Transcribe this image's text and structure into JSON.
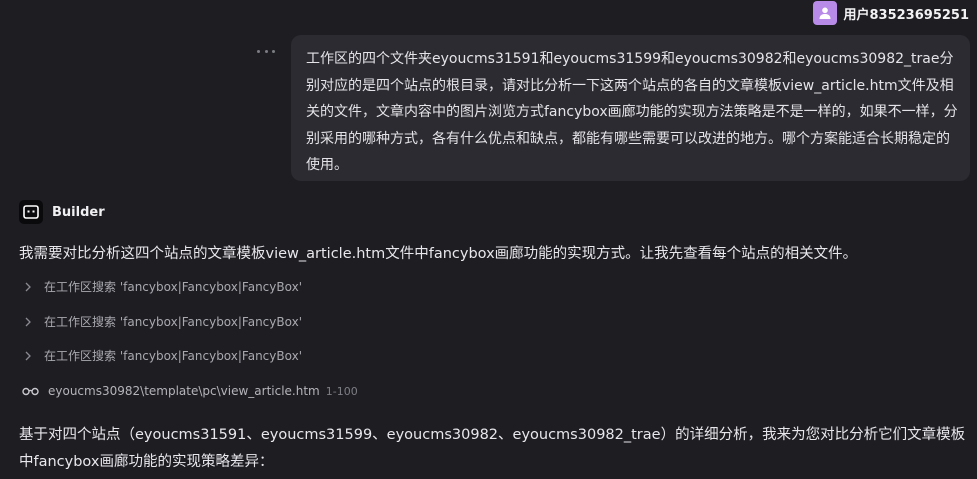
{
  "user": {
    "name": "用户83523695251",
    "avatar_icon": "person-icon",
    "avatar_color": "#b98be8"
  },
  "user_message": {
    "text": "工作区的四个文件夹eyoucms31591和eyoucms31599和eyoucms30982和eyoucms30982_trae分别对应的是四个站点的根目录，请对比分析一下这两个站点的各自的文章模板view_article.htm文件及相关的文件，文章内容中的图片浏览方式fancybox画廊功能的实现方法策略是不是一样的，如果不一样，分别采用的哪种方式，各有什么优点和缺点，都能有哪些需要可以改进的地方。哪个方案能适合长期稳定的使用。",
    "more_icon": "more-dots-icon"
  },
  "assistant": {
    "name": "Builder",
    "logo_icon": "builder-logo-icon",
    "intro": "我需要对比分析这四个站点的文章模板view_article.htm文件中fancybox画廊功能的实现方式。让我先查看每个站点的相关文件。",
    "steps": [
      {
        "label": "在工作区搜索 'fancybox|Fancybox|FancyBox'"
      },
      {
        "label": "在工作区搜索 'fancybox|Fancybox|FancyBox'"
      },
      {
        "label": "在工作区搜索 'fancybox|Fancybox|FancyBox'"
      }
    ],
    "file_view": {
      "path": "eyoucms30982\\template\\pc\\view_article.htm",
      "range": "1-100",
      "icon": "glasses-icon"
    },
    "summary": "基于对四个站点（eyoucms31591、eyoucms31599、eyoucms30982、eyoucms30982_trae）的详细分析，我来为您对比分析它们文章模板中fancybox画廊功能的实现策略差异："
  }
}
